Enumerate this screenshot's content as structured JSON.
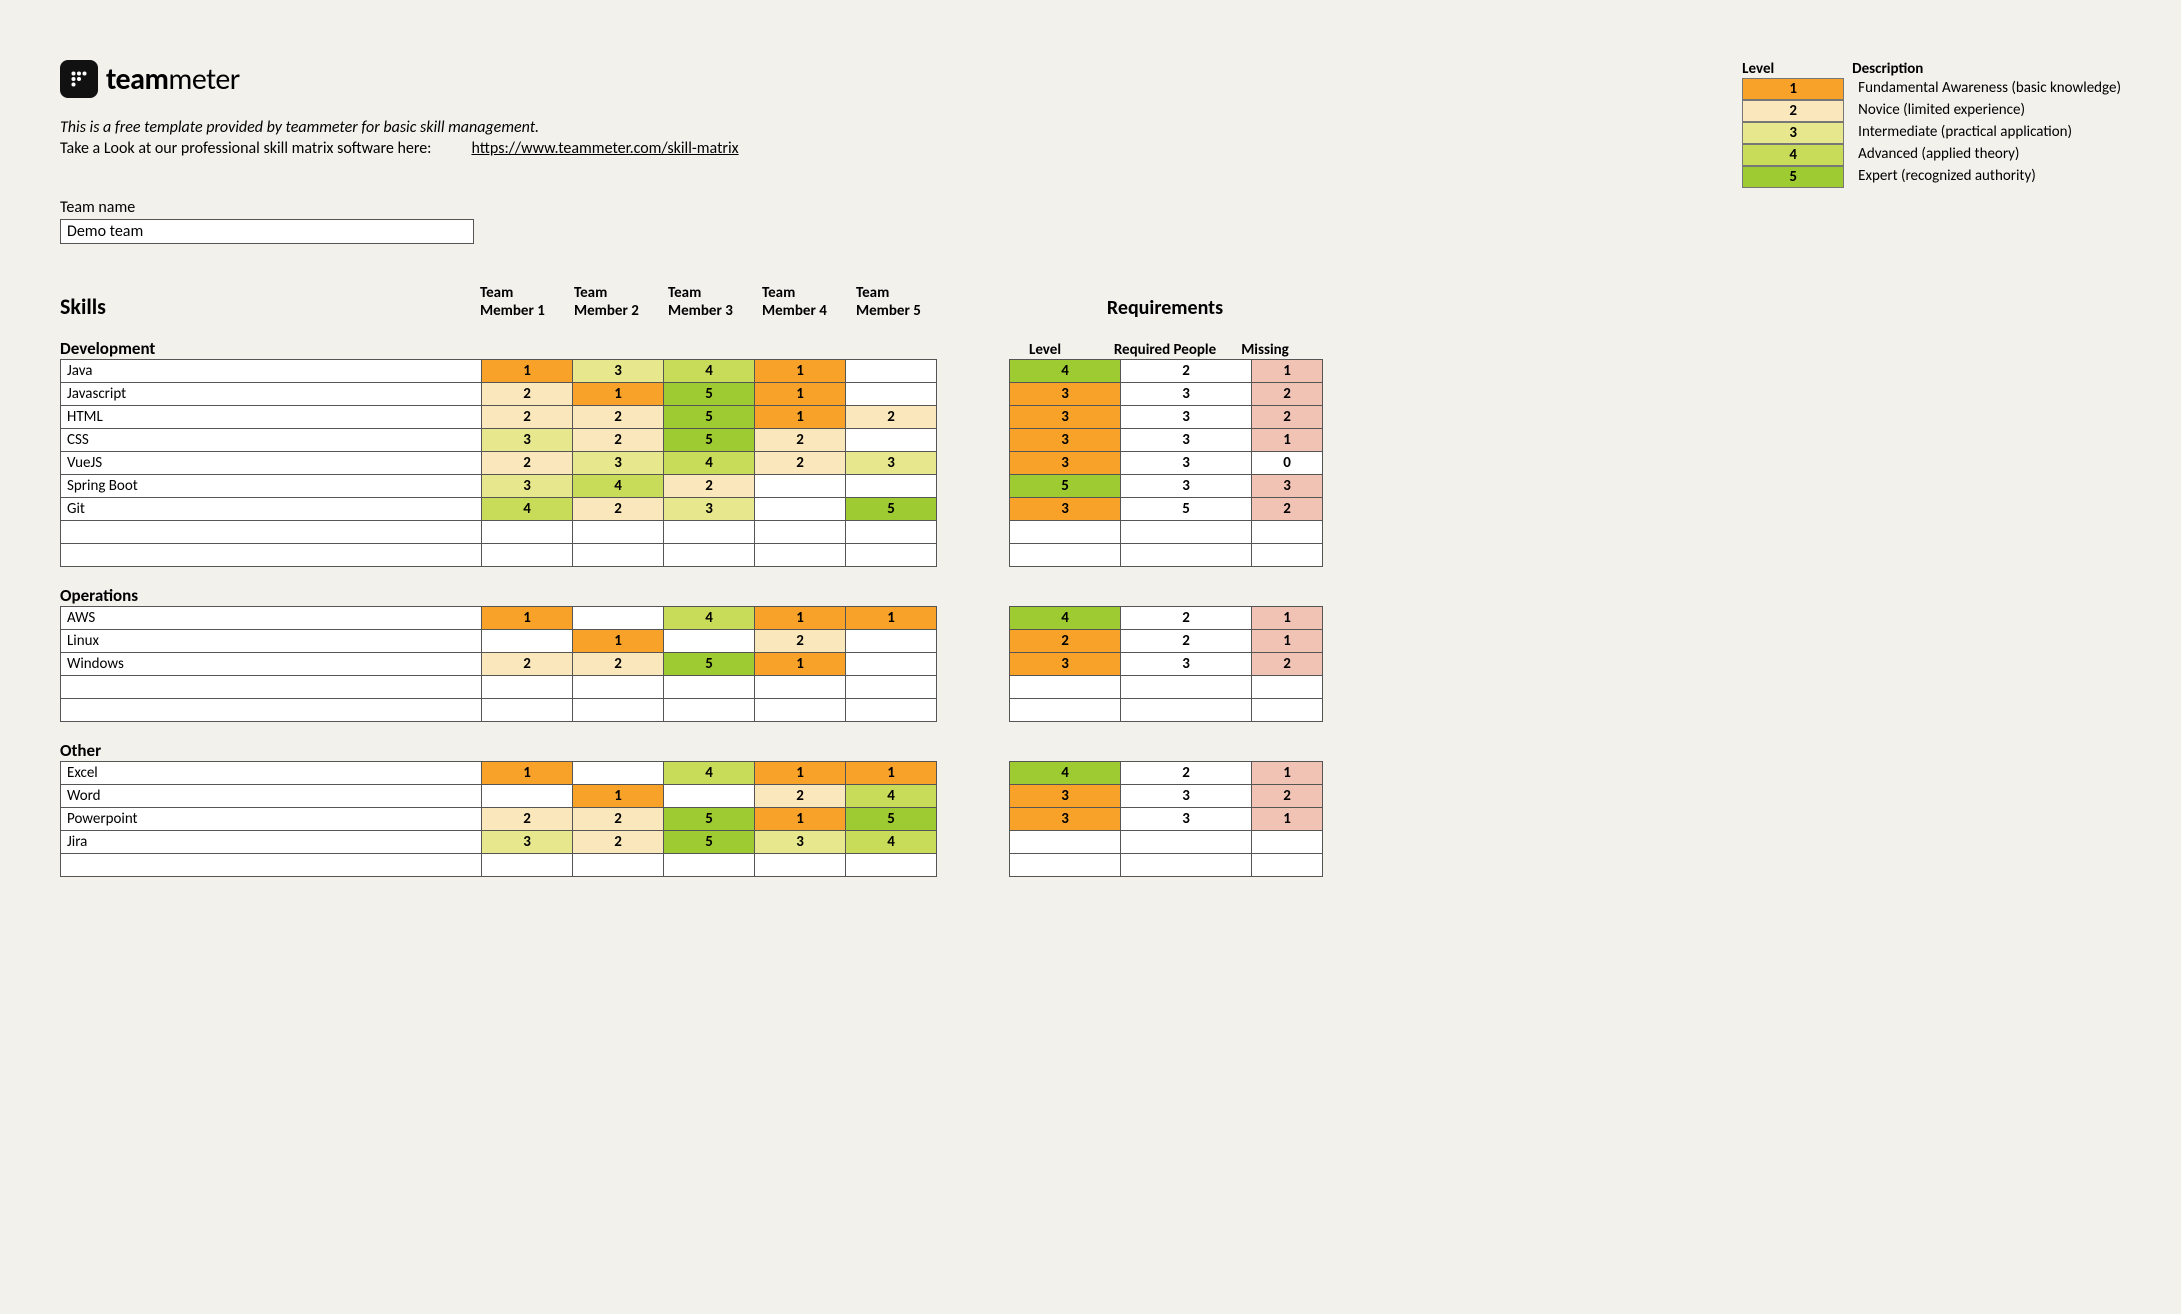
{
  "brand": {
    "bold": "team",
    "light": "meter"
  },
  "intro1": "This is a free template provided by teammeter for basic skill management.",
  "intro2": "Take a Look at our professional skill matrix software here:",
  "link": "https://www.teammeter.com/skill-matrix",
  "legend": {
    "h1": "Level",
    "h2": "Description",
    "rows": [
      {
        "n": "1",
        "d": "Fundamental Awareness (basic knowledge)",
        "c": "lv1"
      },
      {
        "n": "2",
        "d": "Novice (limited experience)",
        "c": "lv2"
      },
      {
        "n": "3",
        "d": "Intermediate (practical application)",
        "c": "lv3"
      },
      {
        "n": "4",
        "d": "Advanced (applied theory)",
        "c": "lv4"
      },
      {
        "n": "5",
        "d": "Expert (recognized authority)",
        "c": "lv5"
      }
    ]
  },
  "teamNameLabel": "Team name",
  "teamName": "Demo team",
  "headers": {
    "skills": "Skills",
    "members": [
      "Team Member 1",
      "Team Member 2",
      "Team Member 3",
      "Team Member 4",
      "Team Member 5"
    ],
    "requirements": "Requirements",
    "reqCols": [
      "Level",
      "Required People",
      "Missing"
    ]
  },
  "categories": [
    {
      "name": "Development",
      "rows": [
        {
          "skill": "Java",
          "v": [
            "1",
            "3",
            "4",
            "1",
            ""
          ],
          "req": [
            "4",
            "2",
            "1"
          ]
        },
        {
          "skill": "Javascript",
          "v": [
            "2",
            "1",
            "5",
            "1",
            ""
          ],
          "req": [
            "3",
            "3",
            "2"
          ]
        },
        {
          "skill": "HTML",
          "v": [
            "2",
            "2",
            "5",
            "1",
            "2"
          ],
          "req": [
            "3",
            "3",
            "2"
          ]
        },
        {
          "skill": "CSS",
          "v": [
            "3",
            "2",
            "5",
            "2",
            ""
          ],
          "req": [
            "3",
            "3",
            "1"
          ]
        },
        {
          "skill": "VueJS",
          "v": [
            "2",
            "3",
            "4",
            "2",
            "3"
          ],
          "req": [
            "3",
            "3",
            "0"
          ]
        },
        {
          "skill": "Spring Boot",
          "v": [
            "3",
            "4",
            "2",
            "",
            ""
          ],
          "req": [
            "5",
            "3",
            "3"
          ]
        },
        {
          "skill": "Git",
          "v": [
            "4",
            "2",
            "3",
            "",
            "5"
          ],
          "req": [
            "3",
            "5",
            "2"
          ]
        },
        {
          "skill": "",
          "v": [
            "",
            "",
            "",
            "",
            ""
          ],
          "req": [
            "",
            "",
            ""
          ]
        },
        {
          "skill": "",
          "v": [
            "",
            "",
            "",
            "",
            ""
          ],
          "req": [
            "",
            "",
            ""
          ]
        }
      ]
    },
    {
      "name": "Operations",
      "rows": [
        {
          "skill": "AWS",
          "v": [
            "1",
            "",
            "4",
            "1",
            "1"
          ],
          "req": [
            "4",
            "2",
            "1"
          ]
        },
        {
          "skill": "Linux",
          "v": [
            "",
            "1",
            "",
            "2",
            ""
          ],
          "req": [
            "2",
            "2",
            "1"
          ]
        },
        {
          "skill": "Windows",
          "v": [
            "2",
            "2",
            "5",
            "1",
            ""
          ],
          "req": [
            "3",
            "3",
            "2"
          ]
        },
        {
          "skill": "",
          "v": [
            "",
            "",
            "",
            "",
            ""
          ],
          "req": [
            "",
            "",
            ""
          ]
        },
        {
          "skill": "",
          "v": [
            "",
            "",
            "",
            "",
            ""
          ],
          "req": [
            "",
            "",
            ""
          ]
        }
      ]
    },
    {
      "name": "Other",
      "rows": [
        {
          "skill": "Excel",
          "v": [
            "1",
            "",
            "4",
            "1",
            "1"
          ],
          "req": [
            "4",
            "2",
            "1"
          ]
        },
        {
          "skill": "Word",
          "v": [
            "",
            "1",
            "",
            "2",
            "4"
          ],
          "req": [
            "3",
            "3",
            "2"
          ]
        },
        {
          "skill": "Powerpoint",
          "v": [
            "2",
            "2",
            "5",
            "1",
            "5"
          ],
          "req": [
            "3",
            "3",
            "1"
          ]
        },
        {
          "skill": "Jira",
          "v": [
            "3",
            "2",
            "5",
            "3",
            "4"
          ],
          "req": [
            "",
            "",
            ""
          ]
        },
        {
          "skill": "",
          "v": [
            "",
            "",
            "",
            "",
            ""
          ],
          "req": [
            "",
            "",
            ""
          ]
        }
      ]
    }
  ],
  "reqLevelColors": {
    "2": "lv1",
    "3": "lv1",
    "4": "lv5",
    "5": "lv5"
  }
}
